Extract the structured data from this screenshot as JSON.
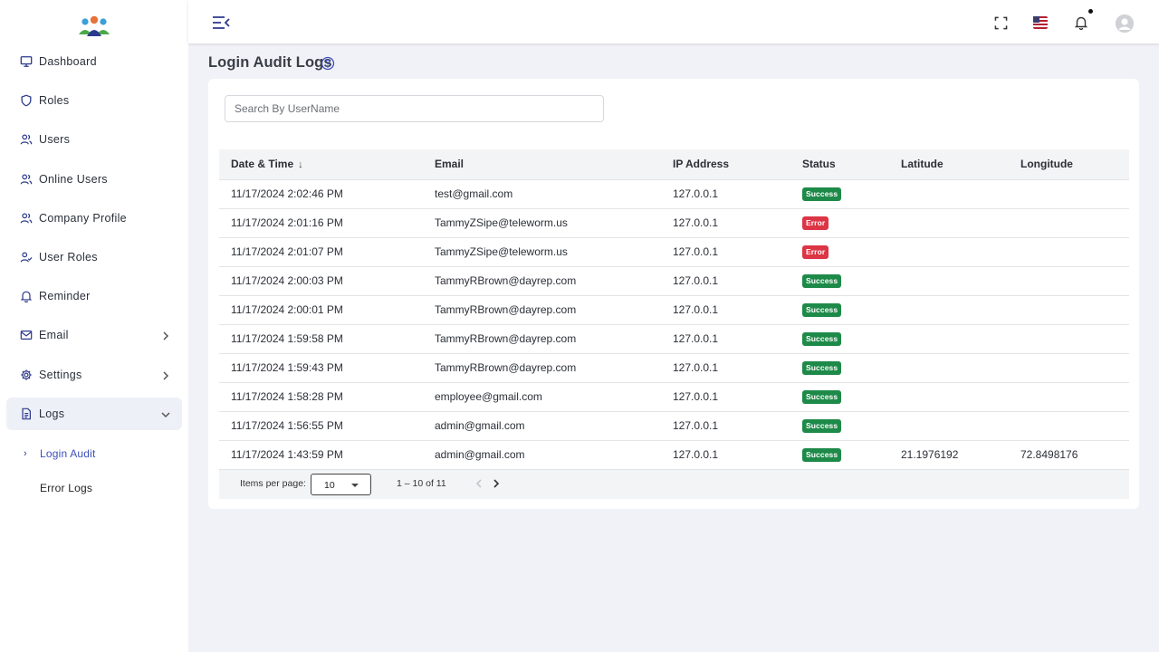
{
  "sidebar": {
    "items": [
      {
        "name": "dashboard",
        "label": "Dashboard",
        "icon": "monitor-icon"
      },
      {
        "name": "roles",
        "label": "Roles",
        "icon": "shield-icon"
      },
      {
        "name": "users",
        "label": "Users",
        "icon": "users-icon"
      },
      {
        "name": "online-users",
        "label": "Online Users",
        "icon": "users-icon"
      },
      {
        "name": "company-profile",
        "label": "Company Profile",
        "icon": "users-icon"
      },
      {
        "name": "user-roles",
        "label": "User Roles",
        "icon": "user-check-icon"
      },
      {
        "name": "reminder",
        "label": "Reminder",
        "icon": "bell-icon"
      },
      {
        "name": "email",
        "label": "Email",
        "icon": "mail-icon"
      },
      {
        "name": "settings",
        "label": "Settings",
        "icon": "gear-icon"
      },
      {
        "name": "logs",
        "label": "Logs",
        "icon": "document-icon"
      }
    ],
    "logs_sub": [
      {
        "label": "Login Audit"
      },
      {
        "label": "Error Logs"
      }
    ]
  },
  "page": {
    "title": "Login Audit Logs"
  },
  "search": {
    "placeholder": "Search By UserName",
    "value": ""
  },
  "table": {
    "columns": [
      "Date & Time",
      "Email",
      "IP Address",
      "Status",
      "Latitude",
      "Longitude"
    ],
    "rows": [
      {
        "datetime": "11/17/2024 2:02:46 PM",
        "email": "test@gmail.com",
        "ip": "127.0.0.1",
        "status": "Success",
        "latitude": "",
        "longitude": ""
      },
      {
        "datetime": "11/17/2024 2:01:16 PM",
        "email": "TammyZSipe@teleworm.us",
        "ip": "127.0.0.1",
        "status": "Error",
        "latitude": "",
        "longitude": ""
      },
      {
        "datetime": "11/17/2024 2:01:07 PM",
        "email": "TammyZSipe@teleworm.us",
        "ip": "127.0.0.1",
        "status": "Error",
        "latitude": "",
        "longitude": ""
      },
      {
        "datetime": "11/17/2024 2:00:03 PM",
        "email": "TammyRBrown@dayrep.com",
        "ip": "127.0.0.1",
        "status": "Success",
        "latitude": "",
        "longitude": ""
      },
      {
        "datetime": "11/17/2024 2:00:01 PM",
        "email": "TammyRBrown@dayrep.com",
        "ip": "127.0.0.1",
        "status": "Success",
        "latitude": "",
        "longitude": ""
      },
      {
        "datetime": "11/17/2024 1:59:58 PM",
        "email": "TammyRBrown@dayrep.com",
        "ip": "127.0.0.1",
        "status": "Success",
        "latitude": "",
        "longitude": ""
      },
      {
        "datetime": "11/17/2024 1:59:43 PM",
        "email": "TammyRBrown@dayrep.com",
        "ip": "127.0.0.1",
        "status": "Success",
        "latitude": "",
        "longitude": ""
      },
      {
        "datetime": "11/17/2024 1:58:28 PM",
        "email": "employee@gmail.com",
        "ip": "127.0.0.1",
        "status": "Success",
        "latitude": "",
        "longitude": ""
      },
      {
        "datetime": "11/17/2024 1:56:55 PM",
        "email": "admin@gmail.com",
        "ip": "127.0.0.1",
        "status": "Success",
        "latitude": "",
        "longitude": ""
      },
      {
        "datetime": "11/17/2024 1:43:59 PM",
        "email": "admin@gmail.com",
        "ip": "127.0.0.1",
        "status": "Success",
        "latitude": "21.1976192",
        "longitude": "72.8498176"
      }
    ]
  },
  "paginator": {
    "items_per_page_label": "Items per page:",
    "items_per_page": "10",
    "range": "1 – 10 of 11"
  },
  "colors": {
    "accent": "#2b3a8c",
    "success": "#1e8a49",
    "error": "#dc3545",
    "background": "#f1f2f7"
  }
}
